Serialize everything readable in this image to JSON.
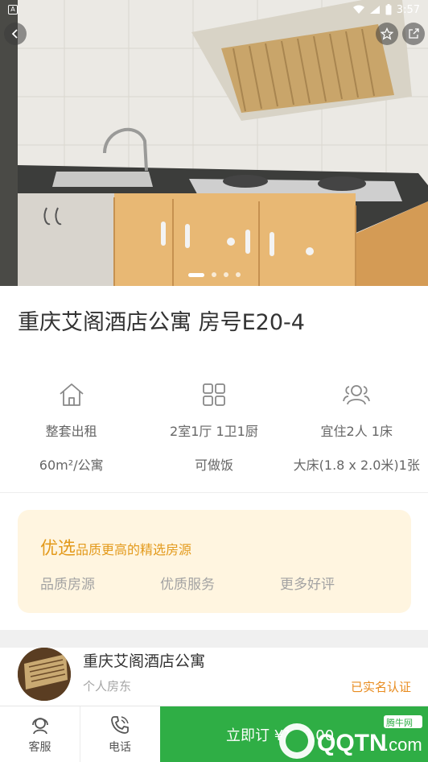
{
  "status_bar": {
    "time": "3:57"
  },
  "listing": {
    "title": "重庆艾阁酒店公寓 房号E20-4"
  },
  "carousel": {
    "slides": 4,
    "active_index": 0
  },
  "features": [
    {
      "icon": "house-icon",
      "line1": "整套出租",
      "line2": "60m²/公寓"
    },
    {
      "icon": "rooms-grid-icon",
      "line1": "2室1厅 1卫1厨",
      "line2": "可做饭"
    },
    {
      "icon": "people-icon",
      "line1": "宜住2人 1床",
      "line2": "大床(1.8 x 2.0米)1张"
    }
  ],
  "quality": {
    "title_big": "优选",
    "title_small": "品质更高的精选房源",
    "items": [
      "品质房源",
      "优质服务",
      "更多好评"
    ]
  },
  "host": {
    "name": "重庆艾阁酒店公寓",
    "type": "个人房东",
    "verified": "已实名认证"
  },
  "bottom_bar": {
    "service_label": "客服",
    "phone_label": "电话",
    "book_label": "立即订 ¥130.00"
  },
  "watermark": {
    "text": "QQTN.com",
    "badge": "腾牛网"
  },
  "colors": {
    "accent_green": "#2fae45",
    "accent_orange": "#e39a1c",
    "card_bg": "#fff5e0"
  }
}
